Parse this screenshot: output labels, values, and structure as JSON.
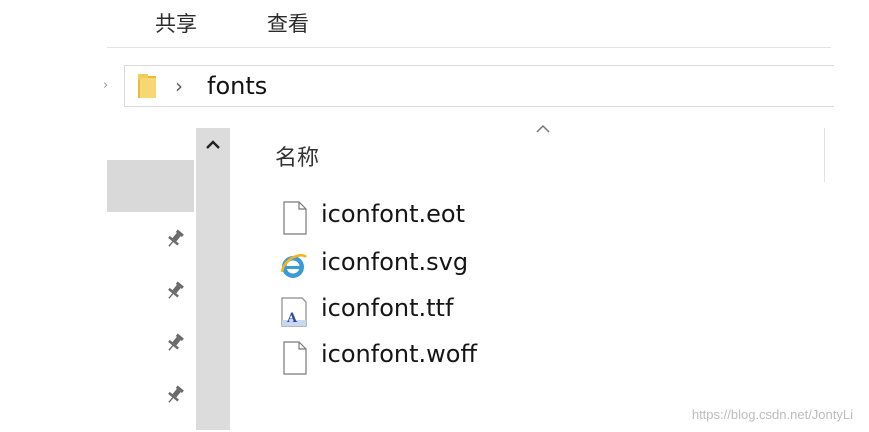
{
  "ribbon": {
    "tabs": [
      "共享",
      "查看"
    ]
  },
  "address_bar": {
    "path": [
      "fonts"
    ]
  },
  "nav_pane": {
    "pinned_count": 4
  },
  "file_list": {
    "column_header": "名称",
    "sort_indicator": "^",
    "files": [
      {
        "name": "iconfont.eot",
        "icon": "blank-file-icon"
      },
      {
        "name": "iconfont.svg",
        "icon": "ie-browser-icon"
      },
      {
        "name": "iconfont.ttf",
        "icon": "font-file-icon"
      },
      {
        "name": "iconfont.woff",
        "icon": "blank-file-icon"
      }
    ]
  },
  "watermark": "https://blog.csdn.net/JontyLi"
}
